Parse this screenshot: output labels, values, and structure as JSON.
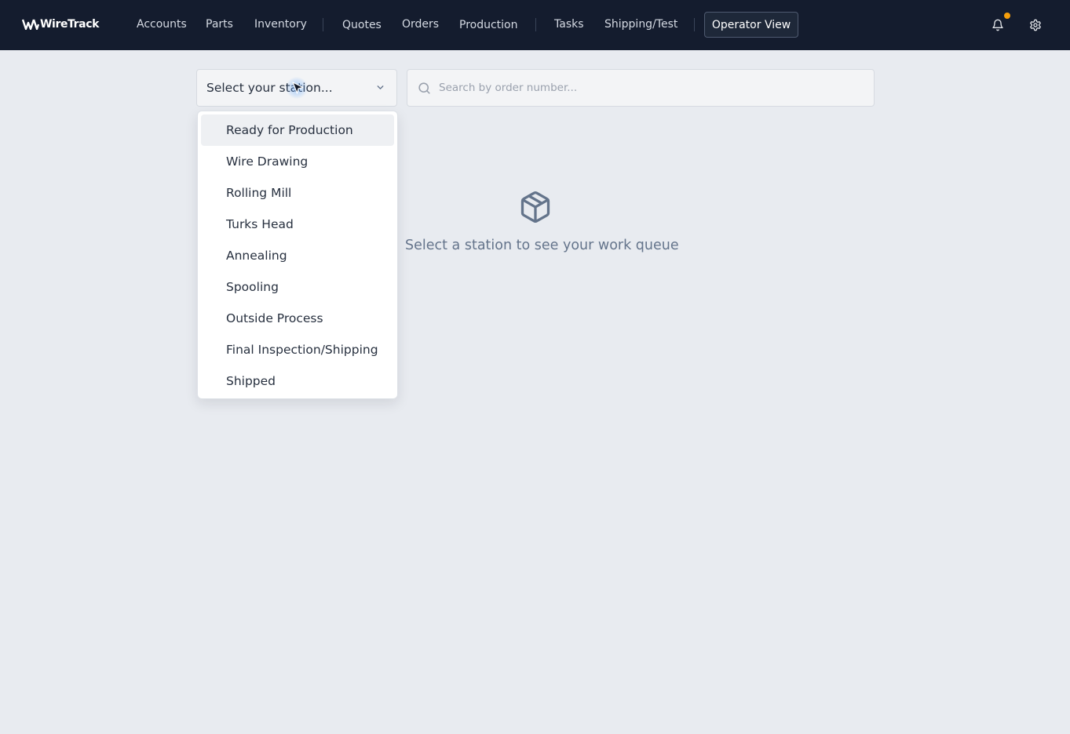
{
  "app": {
    "logo_text": "WireTrack"
  },
  "nav": {
    "items": [
      {
        "label": "Accounts"
      },
      {
        "label": "Parts"
      },
      {
        "label": "Inventory"
      },
      {
        "label": "Quotes"
      },
      {
        "label": "Orders"
      },
      {
        "label": "Production"
      },
      {
        "label": "Tasks"
      },
      {
        "label": "Shipping/Test"
      }
    ],
    "operator_button": "Operator View",
    "icons": {
      "notifications": "bell-icon",
      "settings": "gear-icon"
    },
    "notification_dot_color": "#f59e0b"
  },
  "station_select": {
    "placeholder": "Select your station...",
    "options": [
      {
        "label": "Ready for Production"
      },
      {
        "label": "Wire Drawing"
      },
      {
        "label": "Rolling Mill"
      },
      {
        "label": "Turks Head"
      },
      {
        "label": "Annealing"
      },
      {
        "label": "Spooling"
      },
      {
        "label": "Outside Process"
      },
      {
        "label": "Final Inspection/Shipping"
      },
      {
        "label": "Shipped"
      }
    ],
    "highlighted_option": "Ready for Production"
  },
  "search": {
    "placeholder": "Search by order number...",
    "value": ""
  },
  "empty_state": {
    "icon": "package-icon",
    "message": "Select a station to see your work queue"
  },
  "colors": {
    "topbar": "#141c2e",
    "page_bg": "#e8ebf0",
    "accent": "#f59e0b"
  }
}
